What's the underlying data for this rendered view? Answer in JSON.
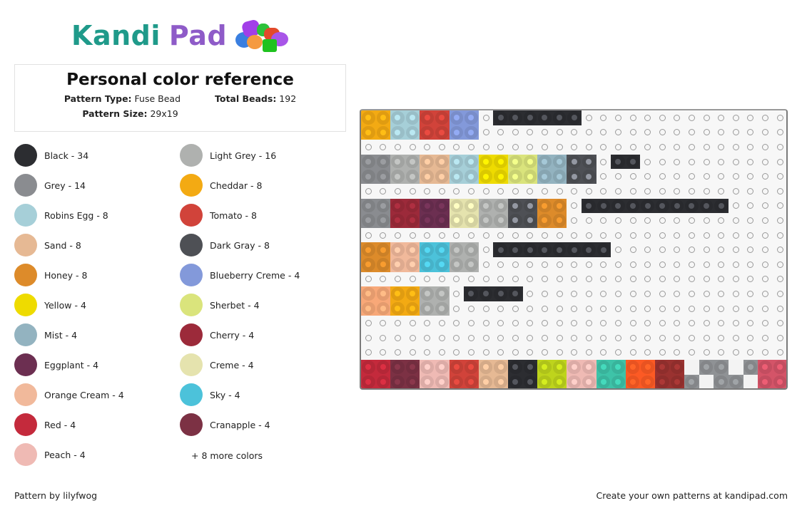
{
  "brand": {
    "name_part1": "Kandi",
    "name_part2": "Pad",
    "logo_icon": "bead-pile-icon"
  },
  "pattern": {
    "title": "Personal color reference",
    "type_label": "Pattern Type:",
    "type_value": "Fuse Bead",
    "total_label": "Total Beads:",
    "total_value": "192",
    "size_label": "Pattern Size:",
    "size_value": "29x19"
  },
  "legend": {
    "left": [
      {
        "label": "Black - 34",
        "color": "#2c2d31"
      },
      {
        "label": "Grey - 14",
        "color": "#8a8c90"
      },
      {
        "label": "Robins Egg - 8",
        "color": "#a6cfd8"
      },
      {
        "label": "Sand - 8",
        "color": "#e6b994"
      },
      {
        "label": "Honey - 8",
        "color": "#dd8b2a"
      },
      {
        "label": "Yellow - 4",
        "color": "#eedb00"
      },
      {
        "label": "Mist - 4",
        "color": "#93b3c0"
      },
      {
        "label": "Eggplant - 4",
        "color": "#6c2f51"
      },
      {
        "label": "Orange Cream - 4",
        "color": "#f1b99b"
      },
      {
        "label": "Red - 4",
        "color": "#c42a3c"
      },
      {
        "label": "Peach - 4",
        "color": "#efbab4"
      }
    ],
    "right": [
      {
        "label": "Light Grey - 16",
        "color": "#afb1af"
      },
      {
        "label": "Cheddar - 8",
        "color": "#f3aa13"
      },
      {
        "label": "Tomato - 8",
        "color": "#d1433a"
      },
      {
        "label": "Dark Gray - 8",
        "color": "#4e5055"
      },
      {
        "label": "Blueberry Creme - 4",
        "color": "#8399da"
      },
      {
        "label": "Sherbet - 4",
        "color": "#dae47c"
      },
      {
        "label": "Cherry - 4",
        "color": "#9c2a3a"
      },
      {
        "label": "Creme - 4",
        "color": "#e5e3ae"
      },
      {
        "label": "Sky - 4",
        "color": "#4cc2da"
      },
      {
        "label": "Cranapple - 4",
        "color": "#7c3144"
      }
    ],
    "more": "+ 8 more colors"
  },
  "grid": {
    "columns": 29,
    "rows": 19,
    "palette": {
      "K": "#2c2d31",
      "G": "#8a8c90",
      "R": "#a6cfd8",
      "S": "#e6b994",
      "H": "#dd8b2a",
      "Y": "#eedb00",
      "M": "#93b3c0",
      "E": "#6c2f51",
      "O": "#f1b99b",
      "D": "#c42a3c",
      "P": "#efbab4",
      "L": "#afb1af",
      "C": "#f3aa13",
      "T": "#d1433a",
      "A": "#4e5055",
      "B": "#8399da",
      "W": "#dae47c",
      "Q": "#9c2a3a",
      "F": "#e5e3ae",
      "X": "#4cc2da",
      "N": "#7c3144",
      "U": "#f8a878",
      "V": "#bed41c",
      "I": "#3ec3a8",
      "Z": "#fc5a24",
      "J": "#9a3230",
      "g": "#8f9295",
      "w": "#f3f3f3",
      "k": "#d45468"
    },
    "rows_data": [
      "CCRRTTBB.KKKKKK..............",
      "CCRRTTBB.....................",
      ".............................",
      "GGLLSSRRYYWWMMAA.KK..........",
      "GGLLSSRRYYWWMMAA.............",
      ".............................",
      "GGQQEEFFLLAAHH.KKKKKKKKKK....",
      "GGQQEEFFLLAAHH...............",
      ".............................",
      "HHOOXXLL.KKKKKKKK............",
      "HHOOXXLL.....................",
      ".............................",
      "UUCCLL.KKKK..................",
      "UUCCLL.......................",
      ".............................",
      ".............................",
      ".............................",
      "DDNNPPTTSSKKVVPPIIZZJJwggwgkk",
      "DDNNPPTTSSKKVVPPIIZZJJgwggwkk"
    ]
  },
  "footer": {
    "author": "Pattern by lilyfwog",
    "cta": "Create your own patterns at kandipad.com"
  }
}
